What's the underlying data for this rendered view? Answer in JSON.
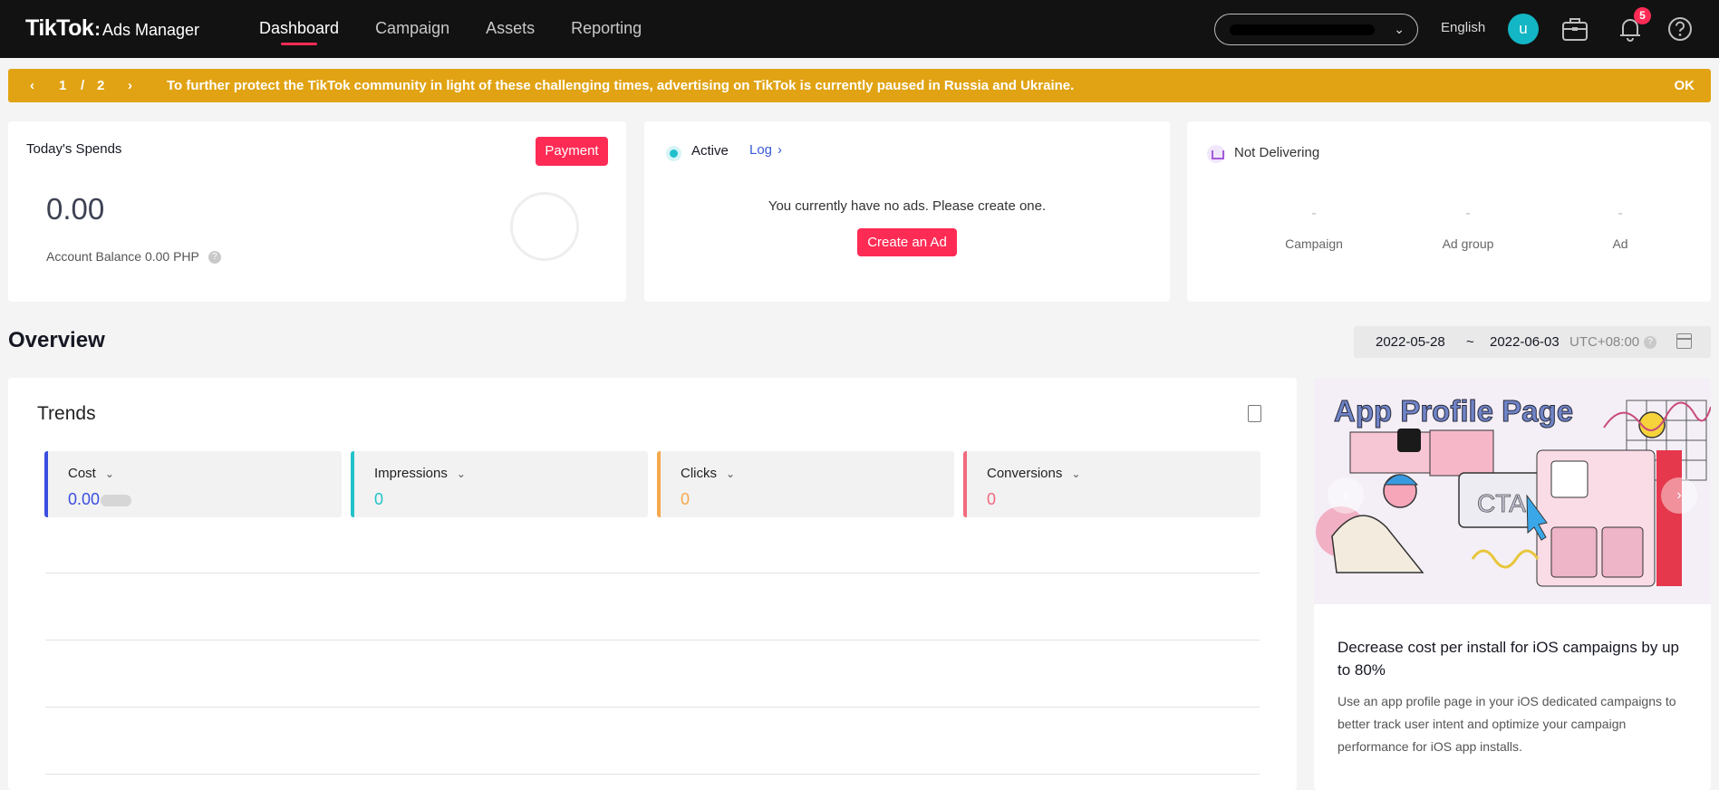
{
  "nav": {
    "logo_brand": "TikTok",
    "logo_colon": ":",
    "logo_product": "Ads Manager",
    "tabs": [
      {
        "label": "Dashboard"
      },
      {
        "label": "Campaign"
      },
      {
        "label": "Assets"
      },
      {
        "label": "Reporting"
      }
    ],
    "language": "English",
    "avatar_letter": "u",
    "notification_count": "5"
  },
  "notice": {
    "page_current": "1",
    "page_sep": "/",
    "page_total": "2",
    "message": "To further protect the TikTok community in light of these challenging times, advertising on TikTok is currently paused in Russia and Ukraine.",
    "ok_label": "OK"
  },
  "spends": {
    "title": "Today's Spends",
    "payment_label": "Payment",
    "amount": "0.00",
    "balance": "Account Balance 0.00 PHP"
  },
  "active": {
    "status": "Active",
    "log_label": "Log",
    "empty_message": "You currently have no ads. Please create one.",
    "create_label": "Create an Ad"
  },
  "not_delivering": {
    "status": "Not Delivering",
    "stats": [
      {
        "value": "-",
        "label": "Campaign"
      },
      {
        "value": "-",
        "label": "Ad group"
      },
      {
        "value": "-",
        "label": "Ad"
      }
    ]
  },
  "overview": {
    "title": "Overview",
    "date_start": "2022-05-28",
    "date_sep": "~",
    "date_end": "2022-06-03",
    "timezone": "UTC+08:00"
  },
  "trends": {
    "title": "Trends",
    "metrics": [
      {
        "name": "Cost",
        "value": "0.00",
        "color": "#3a4fe0"
      },
      {
        "name": "Impressions",
        "value": "0",
        "color": "#22c3c8"
      },
      {
        "name": "Clicks",
        "value": "0",
        "color": "#f5a84c"
      },
      {
        "name": "Conversions",
        "value": "0",
        "color": "#f06a7e"
      }
    ]
  },
  "promo": {
    "art_title": "App Profile Page",
    "art_cta": "CTA",
    "headline": "Decrease cost per install for iOS campaigns by up to 80%",
    "body": "Use an app profile page in your iOS dedicated campaigns to better track user intent and optimize your campaign performance for iOS app installs."
  },
  "colors": {
    "accent": "#fe2c55",
    "notice_bg": "#e1a313",
    "topbar_bg": "#121212"
  }
}
